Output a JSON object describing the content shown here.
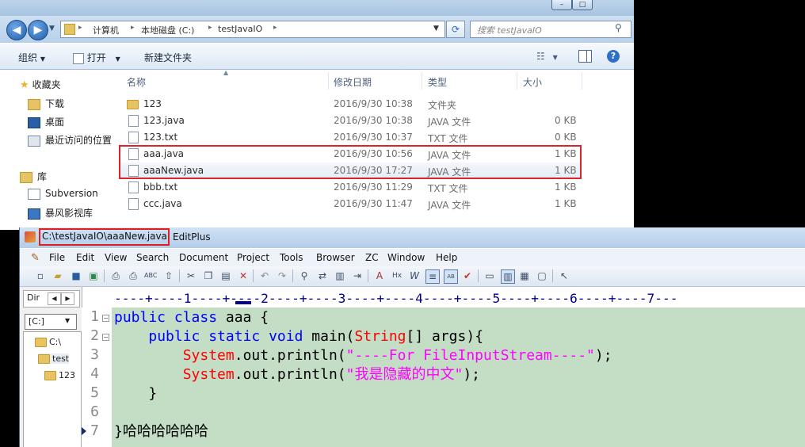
{
  "explorer": {
    "title_buttons": [
      "–",
      "□"
    ],
    "nav": {
      "back_icon": "back-arrow-icon",
      "forward_icon": "forward-arrow-icon",
      "dropdown_icon": "chevron-down-icon"
    },
    "breadcrumb": [
      "计算机",
      "本地磁盘 (C:)",
      "testJavaIO"
    ],
    "search_placeholder": "搜索 testJavaIO",
    "commands": {
      "organize": "组织",
      "open": "打开",
      "new_folder": "新建文件夹"
    },
    "nav_pane": {
      "favorites": "收藏夹",
      "items": [
        "下载",
        "桌面",
        "最近访问的位置"
      ],
      "libraries": "库",
      "lib_items": [
        "Subversion",
        "暴风影视库"
      ]
    },
    "columns": {
      "name": "名称",
      "date": "修改日期",
      "type": "类型",
      "size": "大小"
    },
    "files": [
      {
        "name": "123",
        "date": "2016/9/30 10:38",
        "type": "文件夹",
        "size": "",
        "kind": "folder"
      },
      {
        "name": "123.java",
        "date": "2016/9/30 10:38",
        "type": "JAVA 文件",
        "size": "0 KB",
        "kind": "file"
      },
      {
        "name": "123.txt",
        "date": "2016/9/30 10:37",
        "type": "TXT 文件",
        "size": "0 KB",
        "kind": "file"
      },
      {
        "name": "aaa.java",
        "date": "2016/9/30 10:56",
        "type": "JAVA 文件",
        "size": "1 KB",
        "kind": "file"
      },
      {
        "name": "aaaNew.java",
        "date": "2016/9/30 17:27",
        "type": "JAVA 文件",
        "size": "1 KB",
        "kind": "file"
      },
      {
        "name": "bbb.txt",
        "date": "2016/9/30 11:29",
        "type": "TXT 文件",
        "size": "1 KB",
        "kind": "file"
      },
      {
        "name": "ccc.java",
        "date": "2016/9/30 11:47",
        "type": "JAVA 文件",
        "size": "1 KB",
        "kind": "file"
      }
    ]
  },
  "editplus": {
    "file_path": "C:\\testJavaIO\\aaaNew.java",
    "app_name": "EditPlus",
    "menu": [
      "File",
      "Edit",
      "View",
      "Search",
      "Document",
      "Project",
      "Tools",
      "Browser",
      "ZC",
      "Window",
      "Help"
    ],
    "dir_tab": "Dir",
    "drive": "[C:]",
    "tree": [
      "C:\\",
      "test",
      "123"
    ],
    "ruler": "----+----1----+----2----+----3----+----4----+----5----+----6----+----7---",
    "line_numbers": [
      "1",
      "2",
      "3",
      "4",
      "5",
      "6",
      "7"
    ],
    "code": {
      "l1_kw": "public class",
      "l1_rest": " aaa {",
      "l2_indent": "    ",
      "l2_kw": "public static void",
      "l2_rest": " main(",
      "l2_cls": "String",
      "l2_end": "[] args){",
      "l3_indent": "        ",
      "sys": "System",
      "println": ".out.println(",
      "l3_str": "\"----For FileInputStream----\"",
      "stmt_end": ");",
      "l4_str": "\"我是隐藏的中文\"",
      "l5": "    }",
      "l6": "",
      "l7": "}哈哈哈哈哈哈"
    },
    "colors": {
      "editor_bg": "#c4dec6",
      "keyword": "#0000ff",
      "class": "#ff0000",
      "string": "#ff00ff",
      "highlight_box": "#e01e1e"
    }
  }
}
